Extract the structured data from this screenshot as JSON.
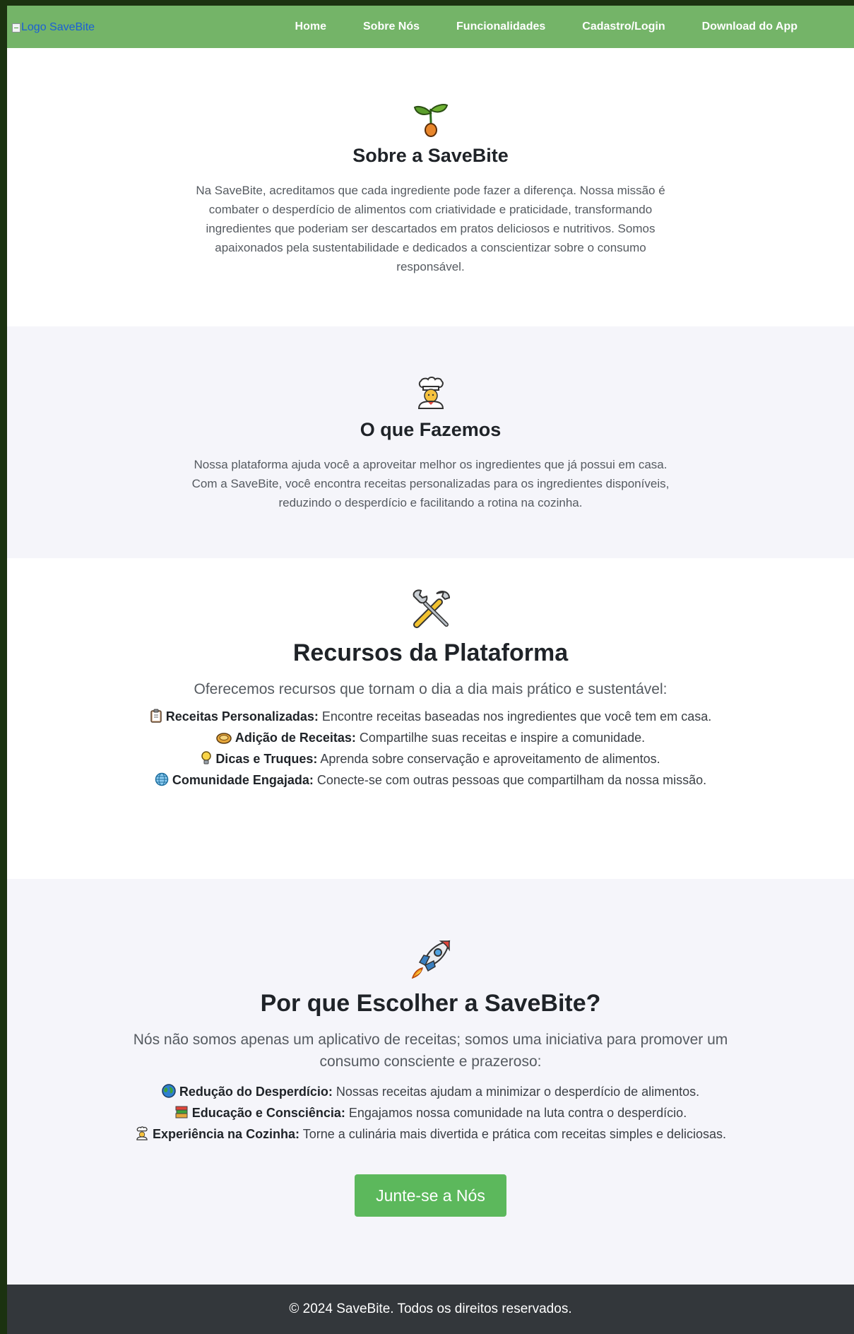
{
  "nav": {
    "logo_alt": "Logo SaveBite",
    "links": [
      "Home",
      "Sobre Nós",
      "Funcionalidades",
      "Cadastro/Login",
      "Download do App"
    ]
  },
  "about": {
    "icon": "seedling-icon",
    "title": "Sobre a SaveBite",
    "text": "Na SaveBite, acreditamos que cada ingrediente pode fazer a diferença. Nossa missão é combater o desperdício de alimentos com criatividade e praticidade, transformando ingredientes que poderiam ser descartados em pratos deliciosos e nutritivos. Somos apaixonados pela sustentabilidade e dedicados a conscientizar sobre o consumo responsável."
  },
  "what": {
    "icon": "chef-icon",
    "title": "O que Fazemos",
    "text": "Nossa plataforma ajuda você a aproveitar melhor os ingredientes que já possui em casa. Com a SaveBite, você encontra receitas personalizadas para os ingredientes disponíveis, reduzindo o desperdício e facilitando a rotina na cozinha."
  },
  "features": {
    "icon": "tools-icon",
    "title": "Recursos da Plataforma",
    "intro": "Oferecemos recursos que tornam o dia a dia mais prático e sustentável:",
    "items": [
      {
        "icon": "clipboard-icon",
        "label": "Receitas Personalizadas:",
        "text": " Encontre receitas baseadas nos ingredientes que você tem em casa."
      },
      {
        "icon": "pie-icon",
        "label": "Adição de Receitas:",
        "text": " Compartilhe suas receitas e inspire a comunidade."
      },
      {
        "icon": "lightbulb-icon",
        "label": "Dicas e Truques:",
        "text": " Aprenda sobre conservação e aproveitamento de alimentos."
      },
      {
        "icon": "globe-icon",
        "label": "Comunidade Engajada:",
        "text": " Conecte-se com outras pessoas que compartilham da nossa missão."
      }
    ]
  },
  "why": {
    "icon": "rocket-icon",
    "title": "Por que Escolher a SaveBite?",
    "intro": "Nós não somos apenas um aplicativo de receitas; somos uma iniciativa para promover um consumo consciente e prazeroso:",
    "items": [
      {
        "icon": "earth-icon",
        "label": "Redução do Desperdício:",
        "text": " Nossas receitas ajudam a minimizar o desperdício de alimentos."
      },
      {
        "icon": "books-icon",
        "label": "Educação e Consciência:",
        "text": " Engajamos nossa comunidade na luta contra o desperdício."
      },
      {
        "icon": "chef-icon",
        "label": "Experiência na Cozinha:",
        "text": " Torne a culinária mais divertida e prática com receitas simples e deliciosas."
      }
    ],
    "cta": "Junte-se a Nós"
  },
  "footer": {
    "text": "© 2024 SaveBite. Todos os direitos reservados."
  },
  "colors": {
    "nav": "#74b468",
    "alt_section": "#f5f5fa",
    "button": "#5cb85c",
    "footer": "#33373b"
  }
}
